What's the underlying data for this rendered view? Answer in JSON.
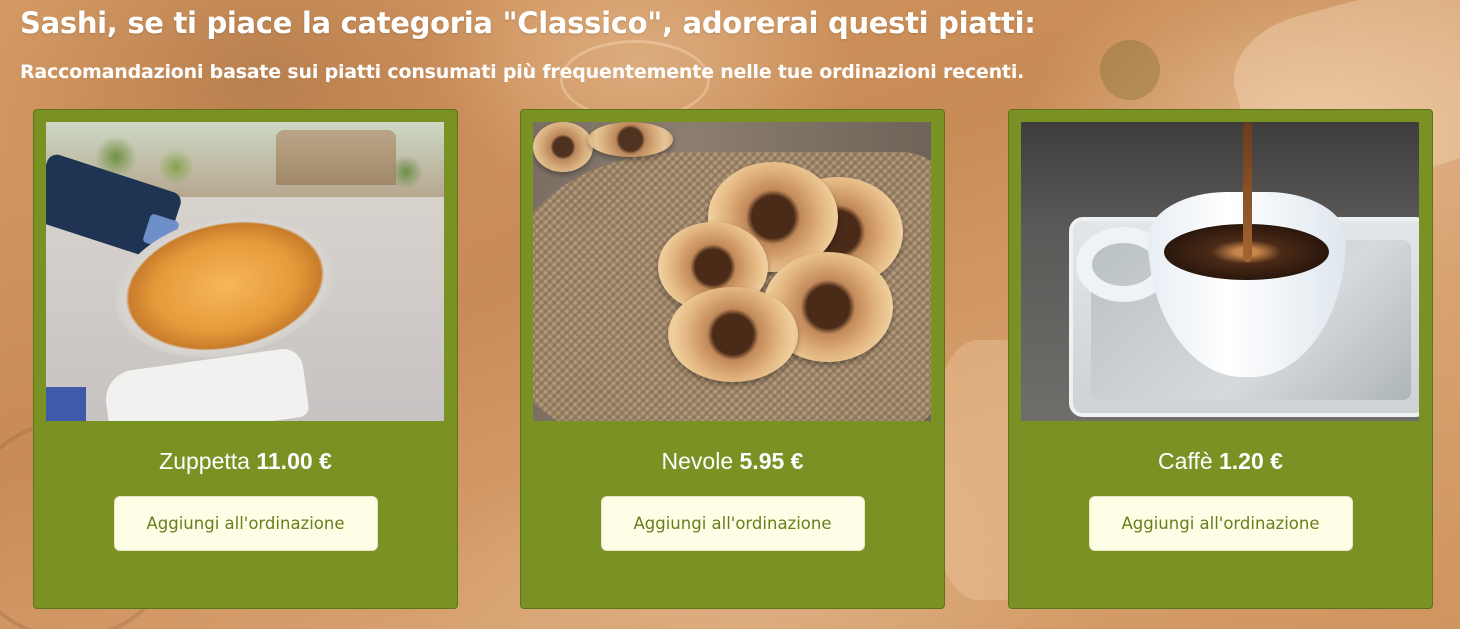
{
  "header": {
    "title": "Sashi, se ti piace la categoria \"Classico\", adorerai questi piatti:",
    "subtitle": "Raccomandazioni basate sui piatti consumati più frequentemente nelle tue ordinazioni recenti."
  },
  "dishes": [
    {
      "name": "Zuppetta",
      "price": "11.00 €",
      "button_label": "Aggiungi all'ordinazione",
      "image": "zuppetta-photo"
    },
    {
      "name": "Nevole",
      "price": "5.95 €",
      "button_label": "Aggiungi all'ordinazione",
      "image": "nevole-photo"
    },
    {
      "name": "Caffè",
      "price": "1.20 €",
      "button_label": "Aggiungi all'ordinazione",
      "image": "caffe-photo"
    }
  ],
  "colors": {
    "card_background": "#7a9123",
    "button_background": "#fefee6",
    "button_text": "#6a7d1d",
    "page_background": "#c98f5c"
  }
}
